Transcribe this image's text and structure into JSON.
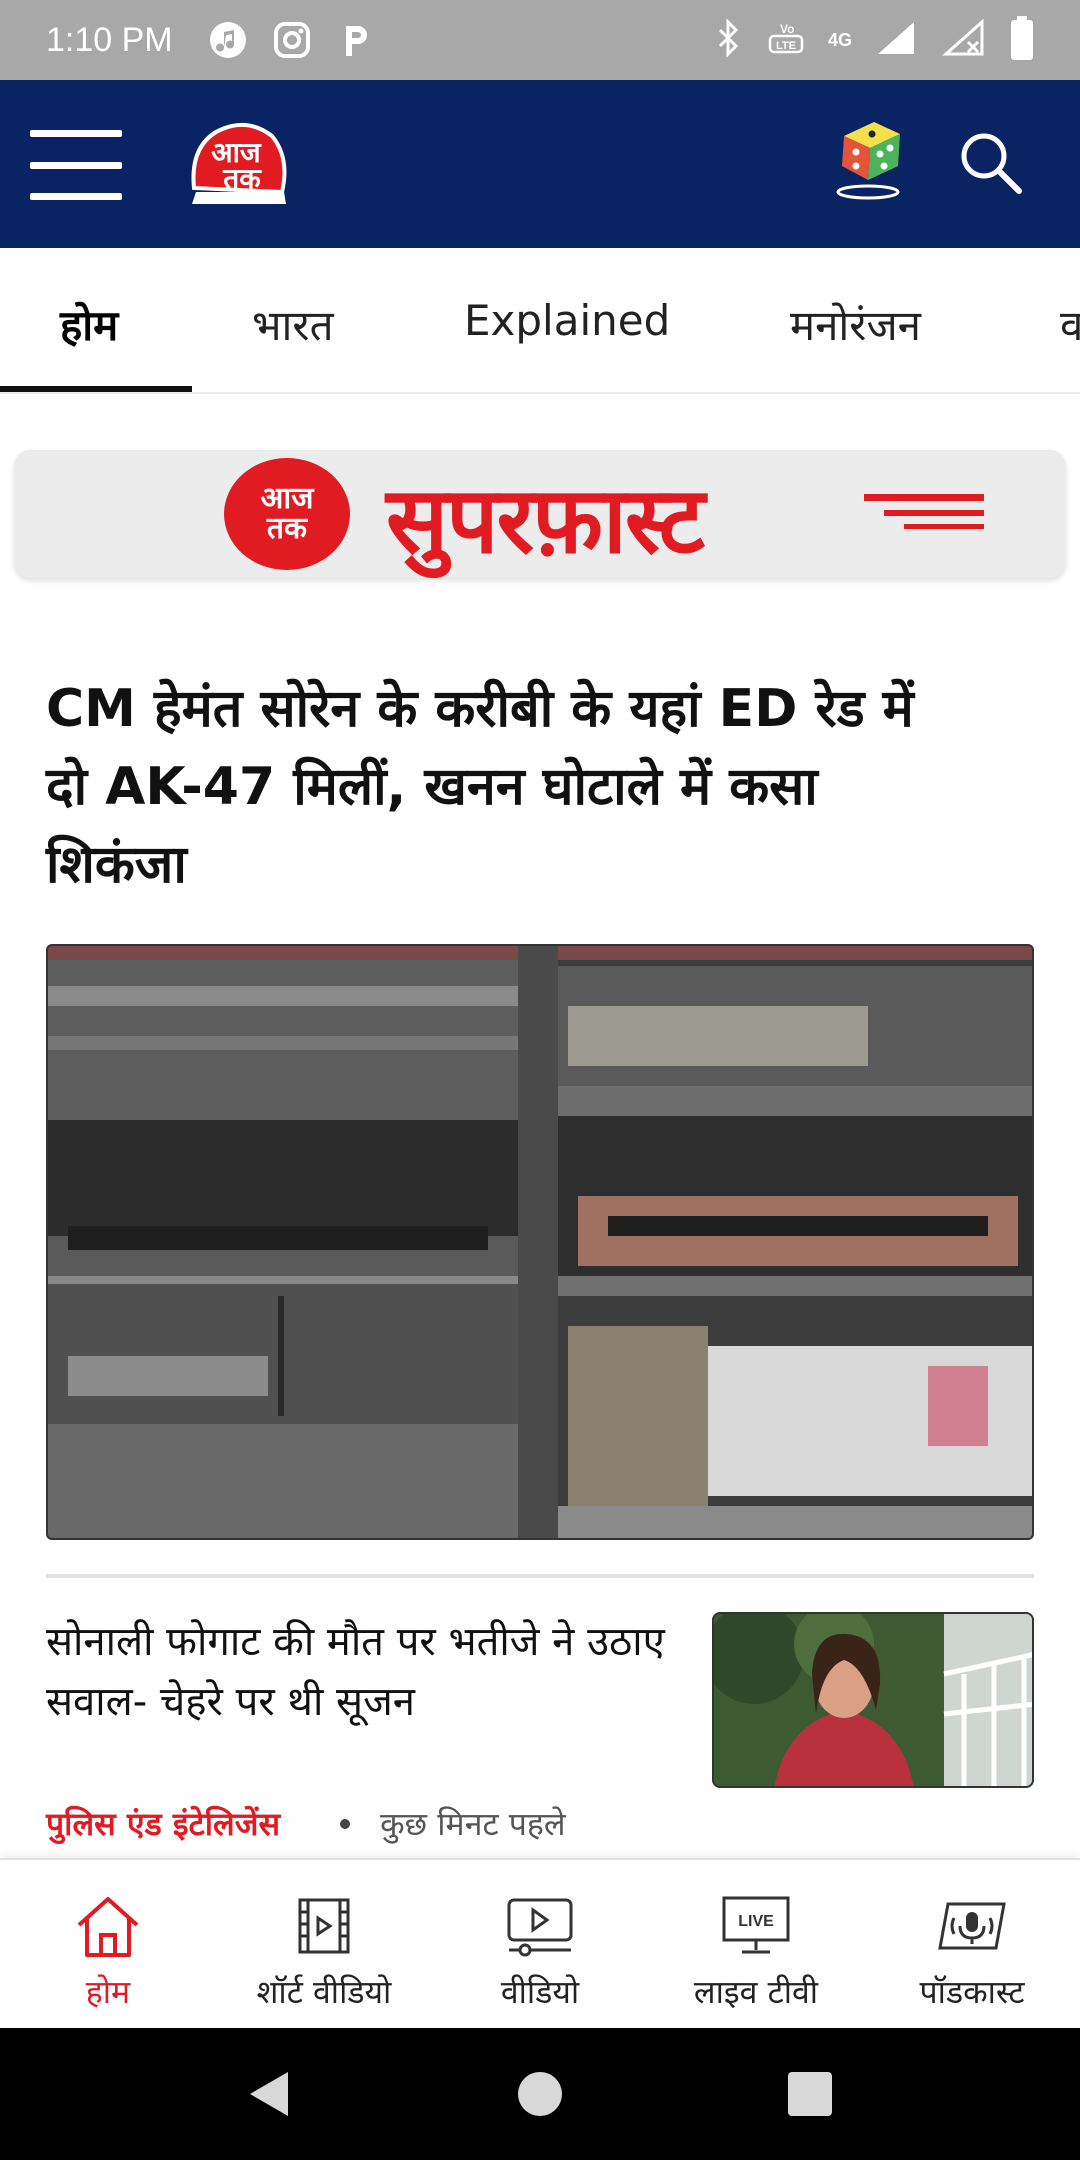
{
  "status_bar": {
    "time": "1:10 PM",
    "network_label": "4G",
    "volte_label": "VoLTE"
  },
  "header": {
    "logo_text": "आज तक",
    "menu_icon": "hamburger-menu-icon",
    "game_icon": "dice-game-icon",
    "search_icon": "search-icon"
  },
  "tabs": [
    {
      "label": "होम",
      "active": true
    },
    {
      "label": "भारत",
      "active": false
    },
    {
      "label": "Explained",
      "active": false
    },
    {
      "label": "मनोरंजन",
      "active": false
    },
    {
      "label": "व",
      "active": false
    }
  ],
  "banner": {
    "logo_line1": "आज",
    "logo_line2": "तक",
    "title": "सुपरफ़ास्ट"
  },
  "lead_story": {
    "headline": "CM हेमंत सोरेन के करीबी के यहां ED रेड में दो AK-47 मिलीं, खनन घोटाले में कसा शिकंजा"
  },
  "story": {
    "headline": "सोनाली फोगाट की मौत पर भतीजे ने उठाए सवाल- चेहरे पर थी सूजन",
    "category": "पुलिस एंड इंटेलिजेंस",
    "time": "कुछ मिनट पहले"
  },
  "bottom_nav": [
    {
      "label": "होम",
      "icon": "home-icon",
      "active": true
    },
    {
      "label": "शॉर्ट वीडियो",
      "icon": "short-video-icon",
      "active": false
    },
    {
      "label": "वीडियो",
      "icon": "video-icon",
      "active": false
    },
    {
      "label": "लाइव टीवी",
      "icon": "live-tv-icon",
      "active": false
    },
    {
      "label": "पॉडकास्ट",
      "icon": "podcast-icon",
      "active": false
    }
  ],
  "colors": {
    "brand_red": "#e11b22",
    "header_navy": "#0a2463",
    "status_gray": "#a8a8a8"
  }
}
